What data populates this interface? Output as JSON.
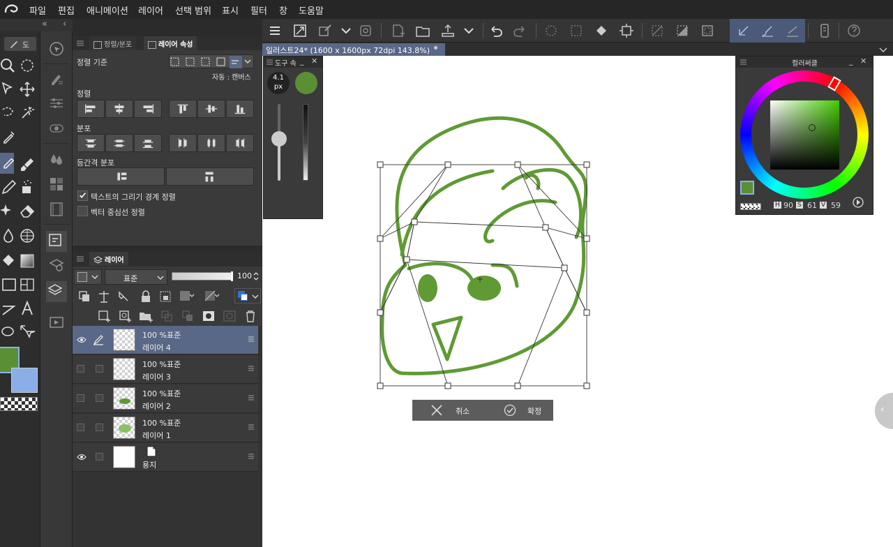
{
  "menu": [
    "파일",
    "편집",
    "애니메이션",
    "레이어",
    "선택 범위",
    "표시",
    "필터",
    "창",
    "도움말"
  ],
  "colors": {
    "main_color": "#5b8f35",
    "sub_color": "#8aaee6",
    "stroke": "#5f9a34",
    "accent": "#5a6887"
  },
  "tool_strip": {
    "collapse_label": "«",
    "subtool_tab": "도"
  },
  "align_panel": {
    "tab_align": "정렬/분포",
    "tab_layer_prop": "레이어 속성",
    "align_basis_label": "정렬 기준",
    "auto_canvas": "자동 : 캔버스",
    "section_align": "정렬",
    "section_distribute": "분포",
    "section_equal": "등간격 분포",
    "opt_text_bounds": "텍스트의 그리기 경계 정렬",
    "opt_text_bounds_checked": true,
    "opt_vector_center": "벡터 중심선 정렬",
    "opt_vector_center_checked": false
  },
  "layer_panel": {
    "tab": "레이어",
    "blend_mode": "표준",
    "opacity": "100",
    "layers": [
      {
        "opacity_mode": "100 %표준",
        "name": "레이어 4",
        "selected": true,
        "visible": true
      },
      {
        "opacity_mode": "100 %표준",
        "name": "레이어 3",
        "selected": false,
        "visible": false
      },
      {
        "opacity_mode": "100 %표준",
        "name": "레이어 2",
        "selected": false,
        "visible": false
      },
      {
        "opacity_mode": "100 %표준",
        "name": "레이어 1",
        "selected": false,
        "visible": false
      },
      {
        "opacity_mode": "",
        "name": "용지",
        "selected": false,
        "visible": true
      }
    ]
  },
  "document": {
    "tab_title": "일러스트24* (1600 x 1600px 72dpi 143.8%)"
  },
  "tool_property": {
    "title": "도구 속",
    "brush_size_value": "4.1",
    "brush_size_unit": "px",
    "size_slider_fraction": 0.55
  },
  "color_panel": {
    "title": "컬러써클",
    "h_label": "H",
    "h_value": "90",
    "s_label": "S",
    "s_value": "61",
    "v_label": "V",
    "v_value": "59"
  },
  "transform": {
    "cancel_label": "취소",
    "confirm_label": "확정"
  }
}
